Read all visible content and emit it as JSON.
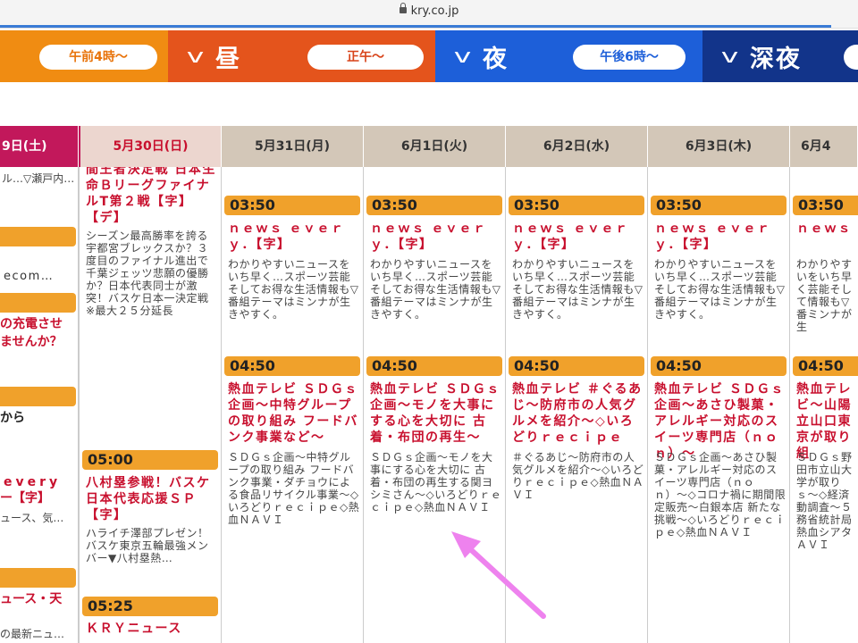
{
  "browser": {
    "url": "kry.co.jp"
  },
  "bands": [
    {
      "name": "",
      "pill": "午前4時〜",
      "color": "#f08c12"
    },
    {
      "name": "昼",
      "pill": "正午〜",
      "color": "#e4541c"
    },
    {
      "name": "夜",
      "pill": "午後6時〜",
      "color": "#1d5fd9"
    },
    {
      "name": "深夜",
      "pill": "",
      "color": "#12348a"
    }
  ],
  "dates": [
    "9日(土)",
    "5月30日(日)",
    "5月31日(月)",
    "6月1日(火)",
    "6月2日(水)",
    "6月3日(木)",
    "6月4"
  ],
  "col0": {
    "top1": "ル…▽瀬戸内…",
    "text1": "ecom…",
    "title1a": "の充電させ",
    "title1b": "ませんか？",
    "text2": "から",
    "title2a": "every",
    "title2b": "ー【字】",
    "text3": "ュース、気…",
    "title3": "ュース・天",
    "text4": "の最新ニュ…"
  },
  "col1": {
    "top_title": "間王者決定戦 日本生命ＢリーグファイナルT第２戦【字】【デ】",
    "top_desc": "シーズン最高勝率を誇る宇都宮ブレックスか？３度目のファイナル進出で千葉ジェッツ悲願の優勝か？日本代表同士が激突！バスケ日本一決定戦 ※最大２５分延長",
    "p2_time": "05:00",
    "p2_title": "八村塁参戦！バスケ日本代表応援ＳＰ【字】",
    "p2_desc": "ハライチ澤部プレゼン！バスケ東京五輪最強メンバー▼八村塁熱…",
    "p3_time": "05:25",
    "p3_title": "ＫＲＹニュース"
  },
  "cols": [
    {
      "p1_time": "03:50",
      "p1_title": "ｎｅｗｓ ｅｖｅｒｙ．【字】",
      "p1_desc": "わかりやすいニュースをいち早く…スポーツ芸能そしてお得な生活情報も▽番組テーマはミンナが生きやすく。",
      "p2_time": "04:50",
      "p2_title": "熱血テレビ ＳＤＧｓ企画〜中特グループの取り組み フードバンク事業など〜",
      "p2_desc": "ＳＤＧｓ企画〜中特グループの取り組み フードバンク事業・ダチョウによる食品リサイクル事業〜◇いろどりｒｅｃｉｐｅ◇熱血ＮＡＶＩ"
    },
    {
      "p1_time": "03:50",
      "p1_title": "ｎｅｗｓ ｅｖｅｒｙ．【字】",
      "p1_desc": "わかりやすいニュースをいち早く…スポーツ芸能そしてお得な生活情報も▽番組テーマはミンナが生きやすく。",
      "p2_time": "04:50",
      "p2_title": "熱血テレビ ＳＤＧｓ企画〜モノを大事にする心を大切に 古着・布団の再生〜",
      "p2_desc": "ＳＤＧｓ企画〜モノを大事にする心を大切に 古着・布団の再生する関ヨシミさん〜◇いろどりｒｅｃｉｐｅ◇熱血ＮＡＶＩ"
    },
    {
      "p1_time": "03:50",
      "p1_title": "ｎｅｗｓ ｅｖｅｒｙ．【字】",
      "p1_desc": "わかりやすいニュースをいち早く…スポーツ芸能そしてお得な生活情報も▽番組テーマはミンナが生きやすく。",
      "p2_time": "04:50",
      "p2_title": "熱血テレビ ＃ぐるあじ〜防府市の人気グルメを紹介〜◇いろどりｒｅｃｉｐｅ",
      "p2_desc": "＃ぐるあじ〜防府市の人気グルメを紹介〜◇いろどりｒｅｃｉｐｅ◇熱血ＮＡＶＩ"
    },
    {
      "p1_time": "03:50",
      "p1_title": "ｎｅｗｓ ｅｖｅｒｙ．【字】",
      "p1_desc": "わかりやすいニュースをいち早く…スポーツ芸能そしてお得な生活情報も▽番組テーマはミンナが生きやすく。",
      "p2_time": "04:50",
      "p2_title": "熱血テレビ ＳＤＧｓ企画〜あさひ製菓・アレルギー対応のスイーツ専門店（ｎｏｎ）〜",
      "p2_desc": "ＳＤＧｓ企画〜あさひ製菓・アレルギー対応のスイーツ専門店（ｎｏｎ）〜◇コロナ禍に期間限定販売〜白銀本店 新たな挑戦〜◇いろどりｒｅｃｉｐｅ◇熱血ＮＡＶＩ"
    },
    {
      "p1_time": "03:50",
      "p1_title": "ｎｅｗｓ ｅｖｅ",
      "p1_desc": "わかりやすいをいち早く芸能そして情報も▽番ミンナが生",
      "p2_time": "04:50",
      "p2_title": "熱血テレビ〜山陽立山口東京が取り組",
      "p2_desc": "ＳＤＧｓ野田市立山大学が取りｓ〜◇経済動調査〜５務省統計局熱血シアタＡＶＩ"
    }
  ]
}
